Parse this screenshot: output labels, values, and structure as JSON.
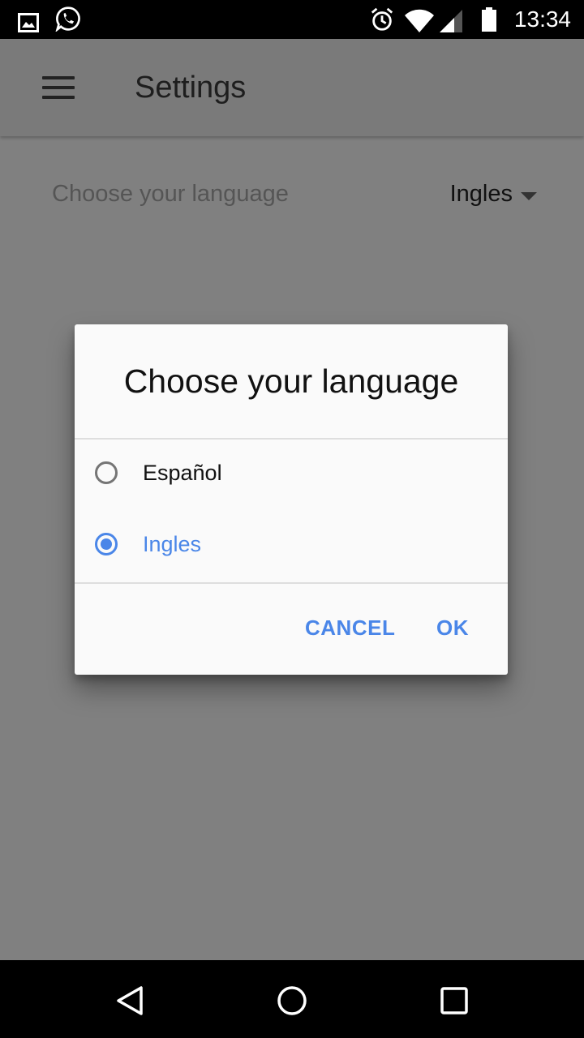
{
  "status_bar": {
    "time": "13:34",
    "icons": [
      "gallery-icon",
      "whatsapp-icon",
      "alarm-icon",
      "wifi-icon",
      "signal-icon",
      "battery-icon"
    ]
  },
  "app_bar": {
    "title": "Settings",
    "menu_icon": "hamburger-menu-icon"
  },
  "settings": {
    "language_label": "Choose your language",
    "language_value": "Ingles"
  },
  "dialog": {
    "title": "Choose your language",
    "options": [
      {
        "label": "Español",
        "selected": false
      },
      {
        "label": "Ingles",
        "selected": true
      }
    ],
    "cancel_label": "CANCEL",
    "ok_label": "OK"
  },
  "nav_bar": {
    "icons": [
      "back-icon",
      "home-icon",
      "recents-icon"
    ]
  },
  "colors": {
    "accent": "#4a86e8",
    "scrim": "#808080",
    "dialog_bg": "#fafafa"
  }
}
